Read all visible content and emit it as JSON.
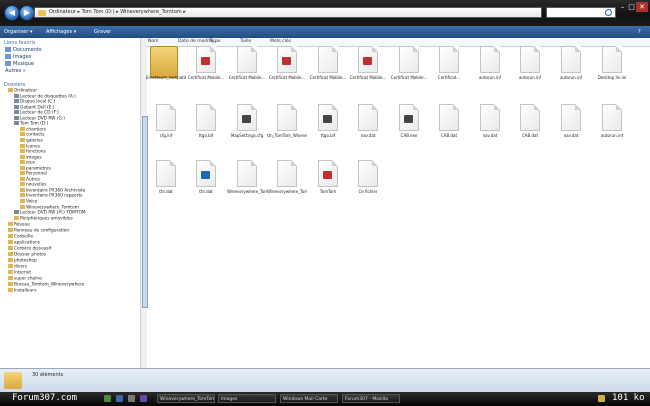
{
  "address": {
    "breadcrumb": "Ordinateur ▸ Tom Tom (D:) ▸ Wineverywhere_Tomtom ▸"
  },
  "toolbar": {
    "organize": "Organiser ▾",
    "views": "Affichages ▾",
    "burn": "Graver",
    "help": "?"
  },
  "columns": [
    "Nom",
    "Date de modific...",
    "Type",
    "Taille",
    "Mots clés"
  ],
  "sidebar": {
    "favorites_header": "Liens favoris",
    "favorites": [
      "Documents",
      "Images",
      "Musique",
      "Autres »"
    ],
    "folders_header": "Dossiers",
    "tree": [
      "Ordinateur",
      "Lecteur de disquettes (A:)",
      "Disque local (C:)",
      "Gabarit Dell (E:)",
      "Lecteur de CD (F:)",
      "Lecteur DVD RW (G:)",
      "Tom Tom (D:)",
      "chantiers",
      "contacts",
      "galeries",
      "Icones",
      "fonctions",
      "images",
      "jeux",
      "paramètres",
      "Personnel",
      "Autres",
      "nouvelles",
      "Inventaire PX360 Archiviste",
      "Inventaire PX360 rapports",
      "Voice",
      "Wineverywhere_Tomtom",
      "Lecteur DVD RW (H:) TOMTOM",
      "Périphériques amovibles",
      "Réseau",
      "Panneau de configuration",
      "Corbeille",
      "applications",
      "Cerbère dissuasif",
      "Dossier photos",
      "photoshop",
      "divers",
      "Internet",
      "super chaîne",
      "Bureau_Tomtom_Wineverywhere",
      "Installeurs"
    ]
  },
  "files": [
    "Emetteurs_compatibles_avec_TomTom",
    "Certificat Mobile...",
    "Certificat Mobile...",
    "Certificat Mobile...",
    "Certificat Mobile...",
    "Certificat Mobile...",
    "Certificat Mobile...",
    "Certificat...",
    "autorun.inf",
    "autorun.inf",
    "autorun.inf",
    "Desktop Ini.ini",
    "cfg.inf",
    "ttgo.bif",
    "MapSettings.cfg",
    "ttn_TomTom_Wineverywhere",
    "ttgo.bif",
    "nav.dat",
    "CAB.exe",
    "CAB.dat",
    "nav.dat",
    "CAB.dat",
    "nav.dat",
    "autorun.inf",
    "ttn.dat",
    "ttn.dat",
    "Wineverywhere_TomTom.cab",
    "Wineverywhere_TomTom",
    "TomTom",
    "Ce fichier"
  ],
  "details": {
    "count": "30 éléments"
  },
  "taskbar": {
    "watermark": "Forum307.com",
    "tasks": [
      "Wineverywhere_TomTom",
      "images",
      "Windows Mail Carte",
      "Forum307 - Mozilla"
    ],
    "clock": "101 ko"
  },
  "colors": {
    "accent": "#234d80",
    "folder": "#e0b84a"
  }
}
